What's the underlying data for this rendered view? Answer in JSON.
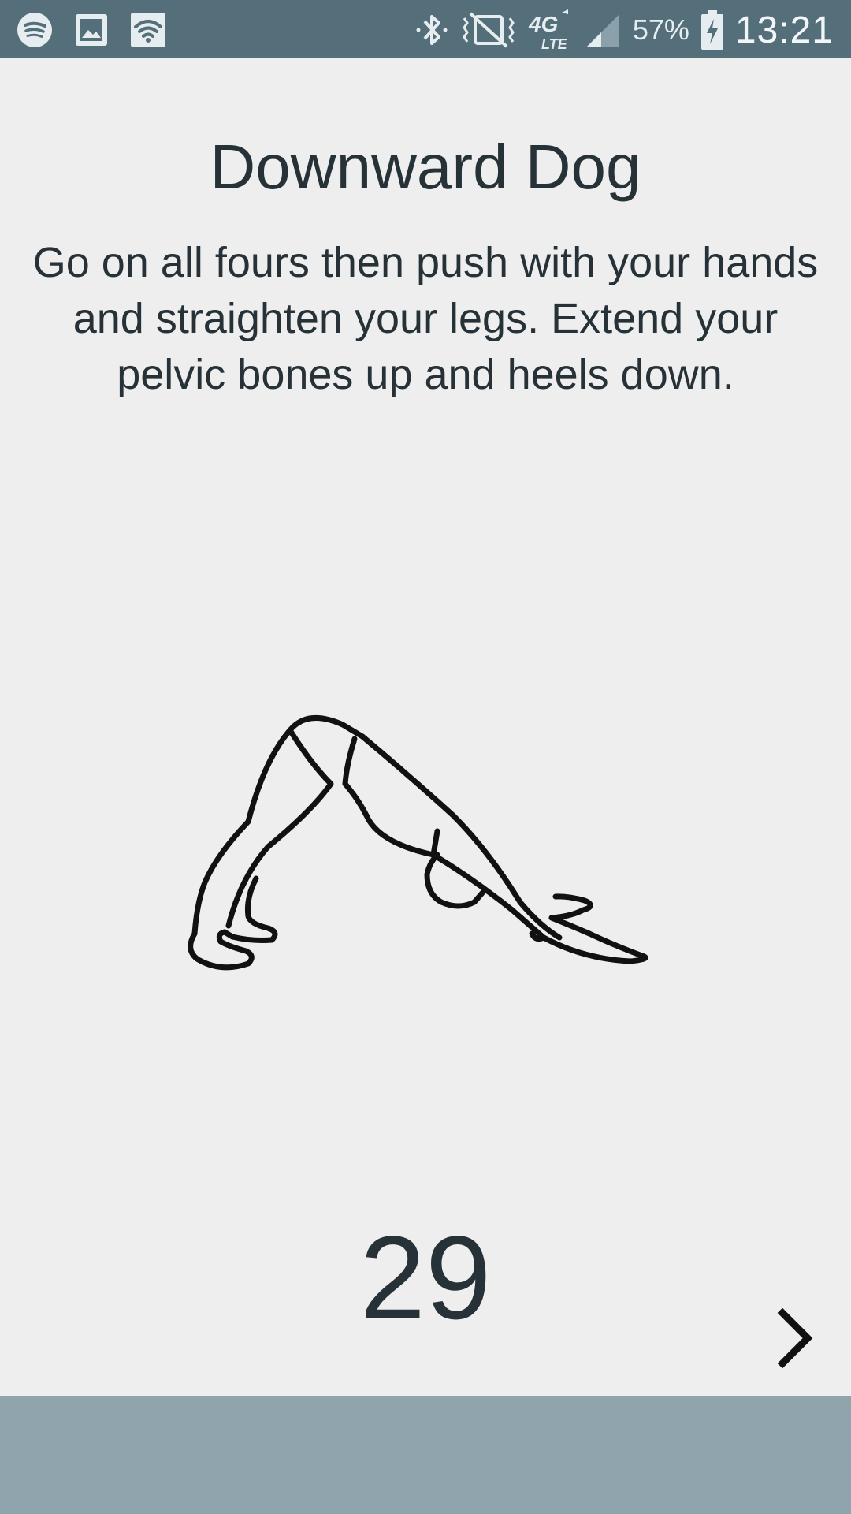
{
  "status_bar": {
    "left_icons": [
      "spotify-icon",
      "gallery-icon",
      "wifi-icon"
    ],
    "right_icons": [
      "bluetooth-icon",
      "vibrate-mute-icon",
      "4g-lte-icon",
      "signal-icon"
    ],
    "network_label": "4G",
    "network_sub_label": "LTE",
    "battery_percent": "57%",
    "battery_icon": "battery-charging-icon",
    "time": "13:21",
    "background_color": "#546e7a"
  },
  "exercise": {
    "title": "Downward Dog",
    "description": "Go on all fours then push with your hands and straighten your legs. Extend your pelvic bones up and heels down.",
    "illustration": "downward-dog-pose-icon",
    "timer_seconds": "29",
    "next_icon": "chevron-right-icon"
  },
  "colors": {
    "text": "#263238",
    "background": "#eeeeee",
    "bottom_bar": "#90a4ae"
  }
}
